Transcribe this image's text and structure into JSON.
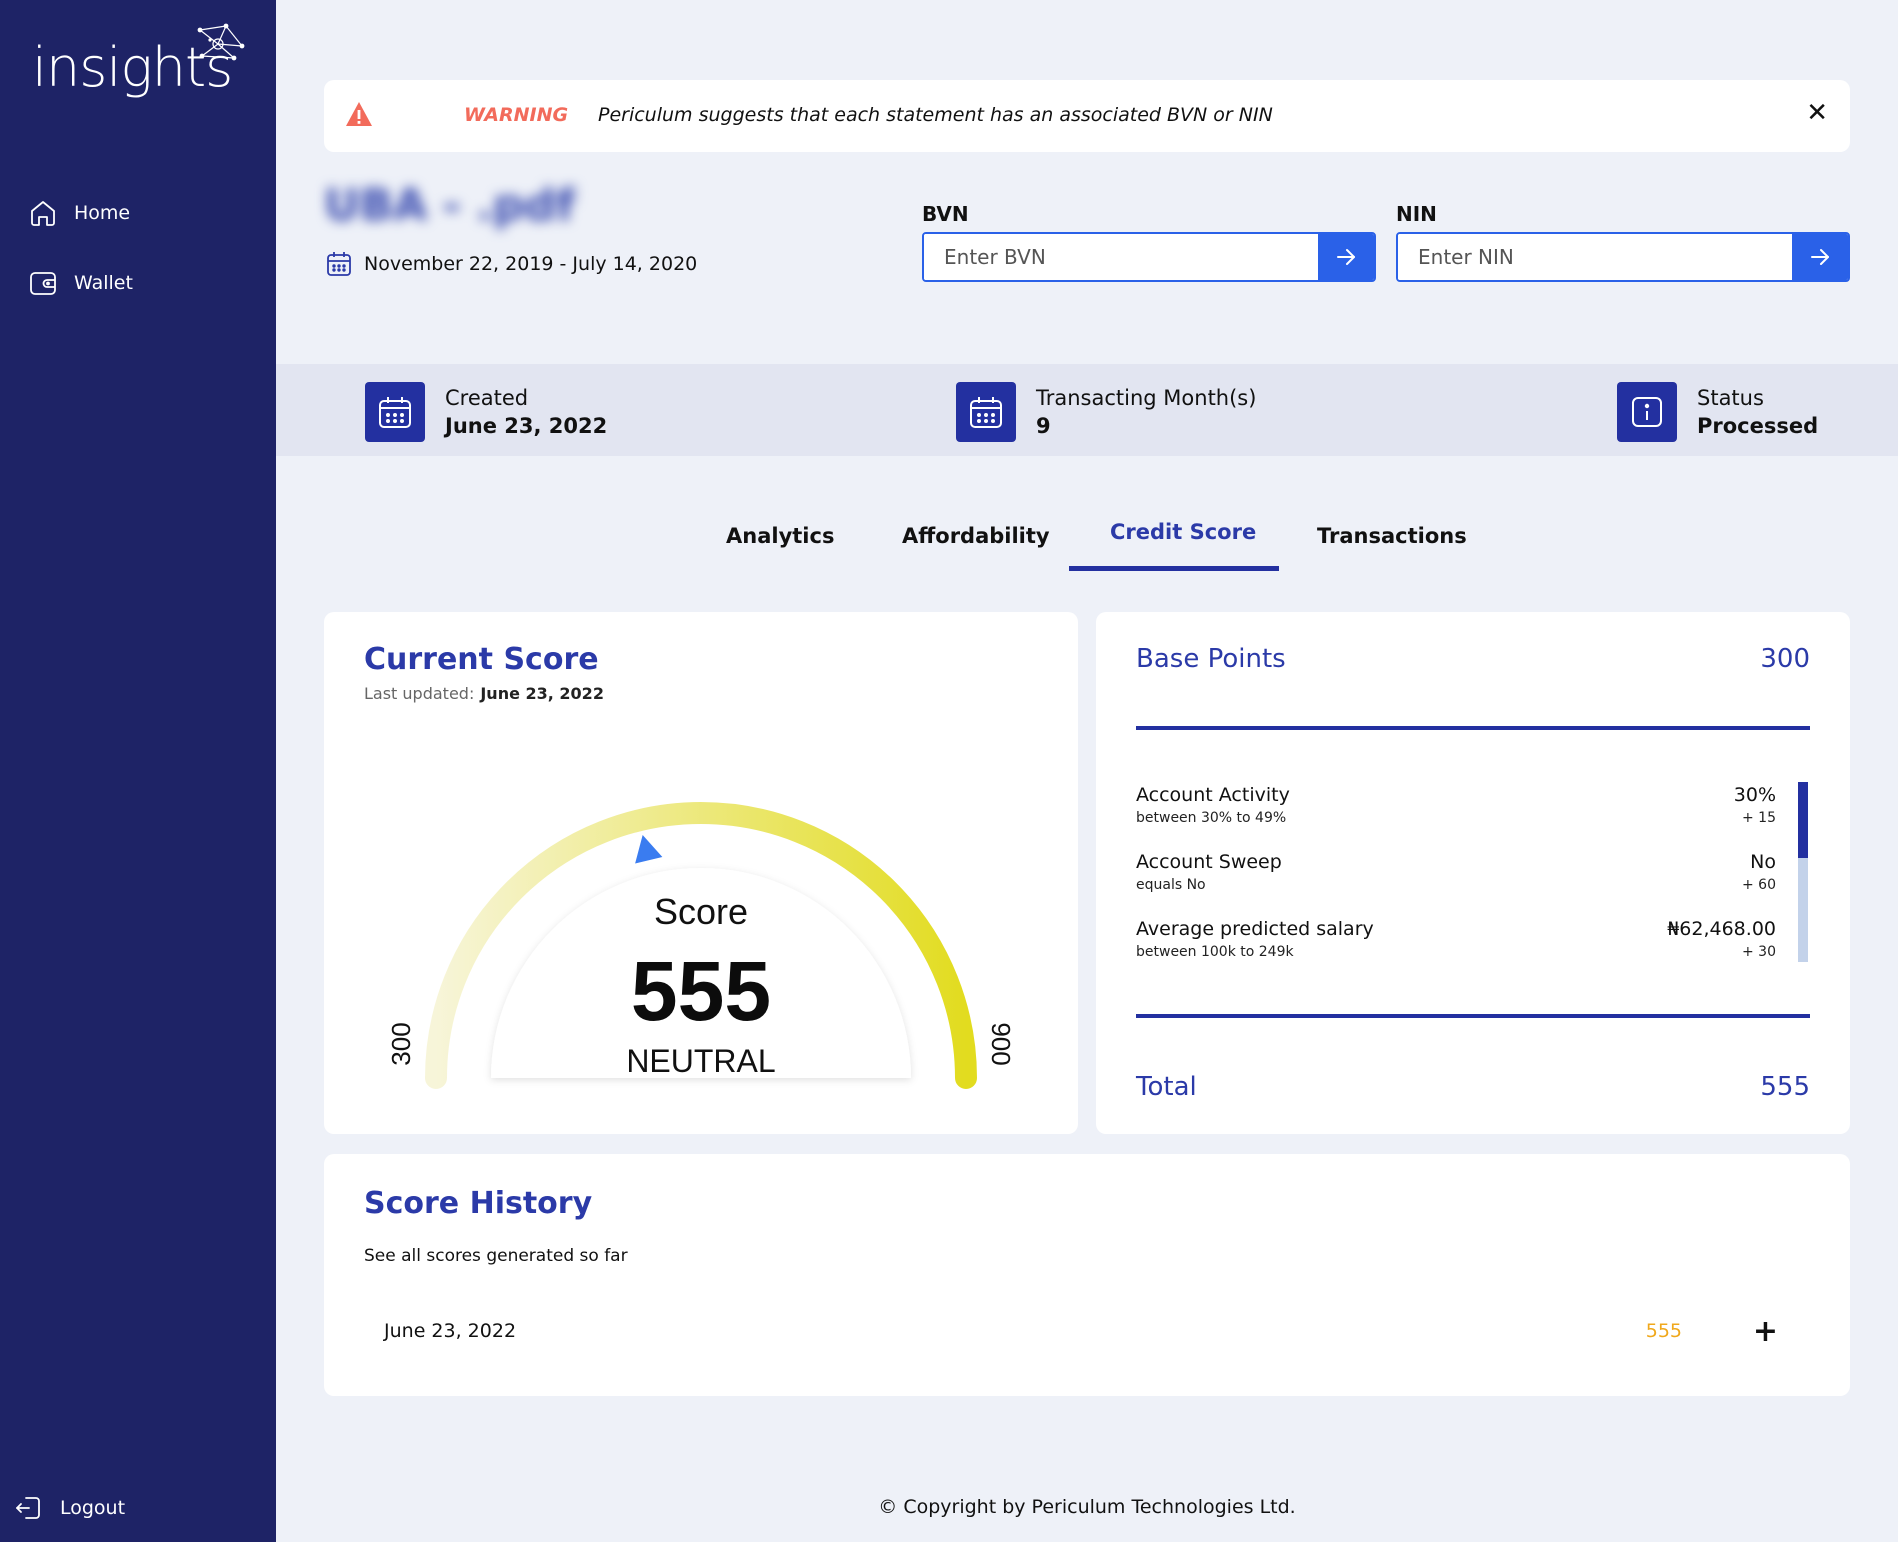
{
  "app": {
    "logo_text": "insights"
  },
  "sidebar": {
    "items": [
      {
        "label": "Home",
        "icon": "home-icon"
      },
      {
        "label": "Wallet",
        "icon": "wallet-icon"
      }
    ],
    "logout_label": "Logout"
  },
  "warning": {
    "label": "WARNING",
    "message": "Periculum suggests that each statement has an associated BVN or NIN",
    "close_glyph": "✕"
  },
  "statement": {
    "file_name": "UBA - .pdf",
    "date_range": "November 22, 2019 - July 14, 2020"
  },
  "identity": {
    "bvn_label": "BVN",
    "bvn_placeholder": "Enter BVN",
    "bvn_value": "",
    "nin_label": "NIN",
    "nin_placeholder": "Enter NIN",
    "nin_value": ""
  },
  "meta": {
    "created_label": "Created",
    "created_value": "June 23, 2022",
    "months_label": "Transacting Month(s)",
    "months_value": "9",
    "status_label": "Status",
    "status_value": "Processed"
  },
  "tabs": [
    {
      "label": "Analytics",
      "active": false
    },
    {
      "label": "Affordability",
      "active": false
    },
    {
      "label": "Credit Score",
      "active": true
    },
    {
      "label": "Transactions",
      "active": false
    }
  ],
  "current_score": {
    "title": "Current Score",
    "last_updated_label": "Last updated:",
    "last_updated_value": "June 23, 2022",
    "score_label": "Score",
    "score_value": "555",
    "rating": "NEUTRAL",
    "min_label": "300",
    "max_label": "900",
    "min": 300,
    "max": 900,
    "value": 555
  },
  "base_points": {
    "title": "Base Points",
    "value": "300",
    "factors": [
      {
        "name": "Account Activity",
        "desc": "between 30% to 49%",
        "value": "30%",
        "points": "+ 15"
      },
      {
        "name": "Account Sweep",
        "desc": "equals No",
        "value": "No",
        "points": "+ 60"
      },
      {
        "name": "Average predicted salary",
        "desc": "between 100k to 249k",
        "value": "₦62,468.00",
        "points": "+ 30"
      }
    ],
    "total_label": "Total",
    "total_value": "555"
  },
  "score_history": {
    "title": "Score History",
    "subtitle": "See all scores generated so far",
    "rows": [
      {
        "date": "June 23, 2022",
        "score": "555",
        "expand_glyph": "+"
      }
    ]
  },
  "footer": {
    "copyright": "© Copyright by Periculum Technologies Ltd."
  },
  "colors": {
    "sidebar": "#1e2366",
    "accent": "#2b3aa8",
    "button": "#2a61e8",
    "warning": "#f26b5b",
    "history_score": "#f0a81c",
    "gauge_start": "#f7f5d9",
    "gauge_end": "#e2dc1f"
  }
}
